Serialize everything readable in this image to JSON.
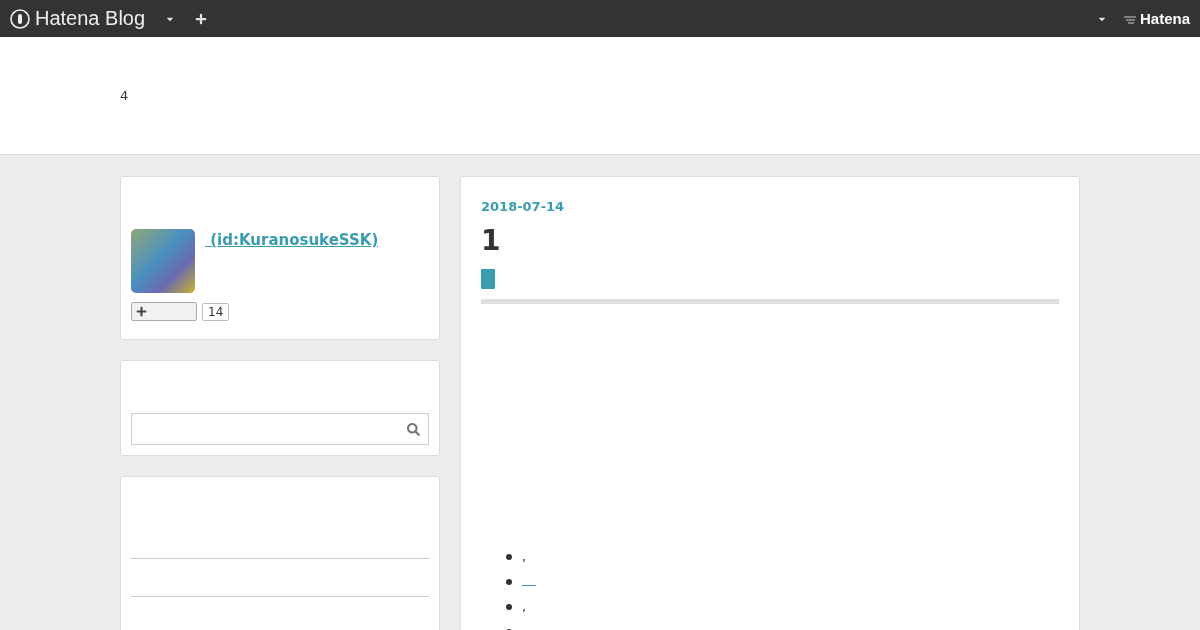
{
  "topbar": {
    "brand": "Hatena Blog",
    "right_brand": "Hatena"
  },
  "blog_header": {
    "title": "4"
  },
  "profile": {
    "name_link": " (id:KuranosukeSSK)",
    "subscriber_count": "14"
  },
  "search": {
    "kind": "field"
  },
  "entry": {
    "date": "2018-07-14",
    "title": "1",
    "list": [
      {
        "kind": "text",
        "text": ","
      },
      {
        "kind": "link"
      },
      {
        "kind": "text",
        "text": ","
      },
      {
        "kind": "empty"
      }
    ]
  }
}
